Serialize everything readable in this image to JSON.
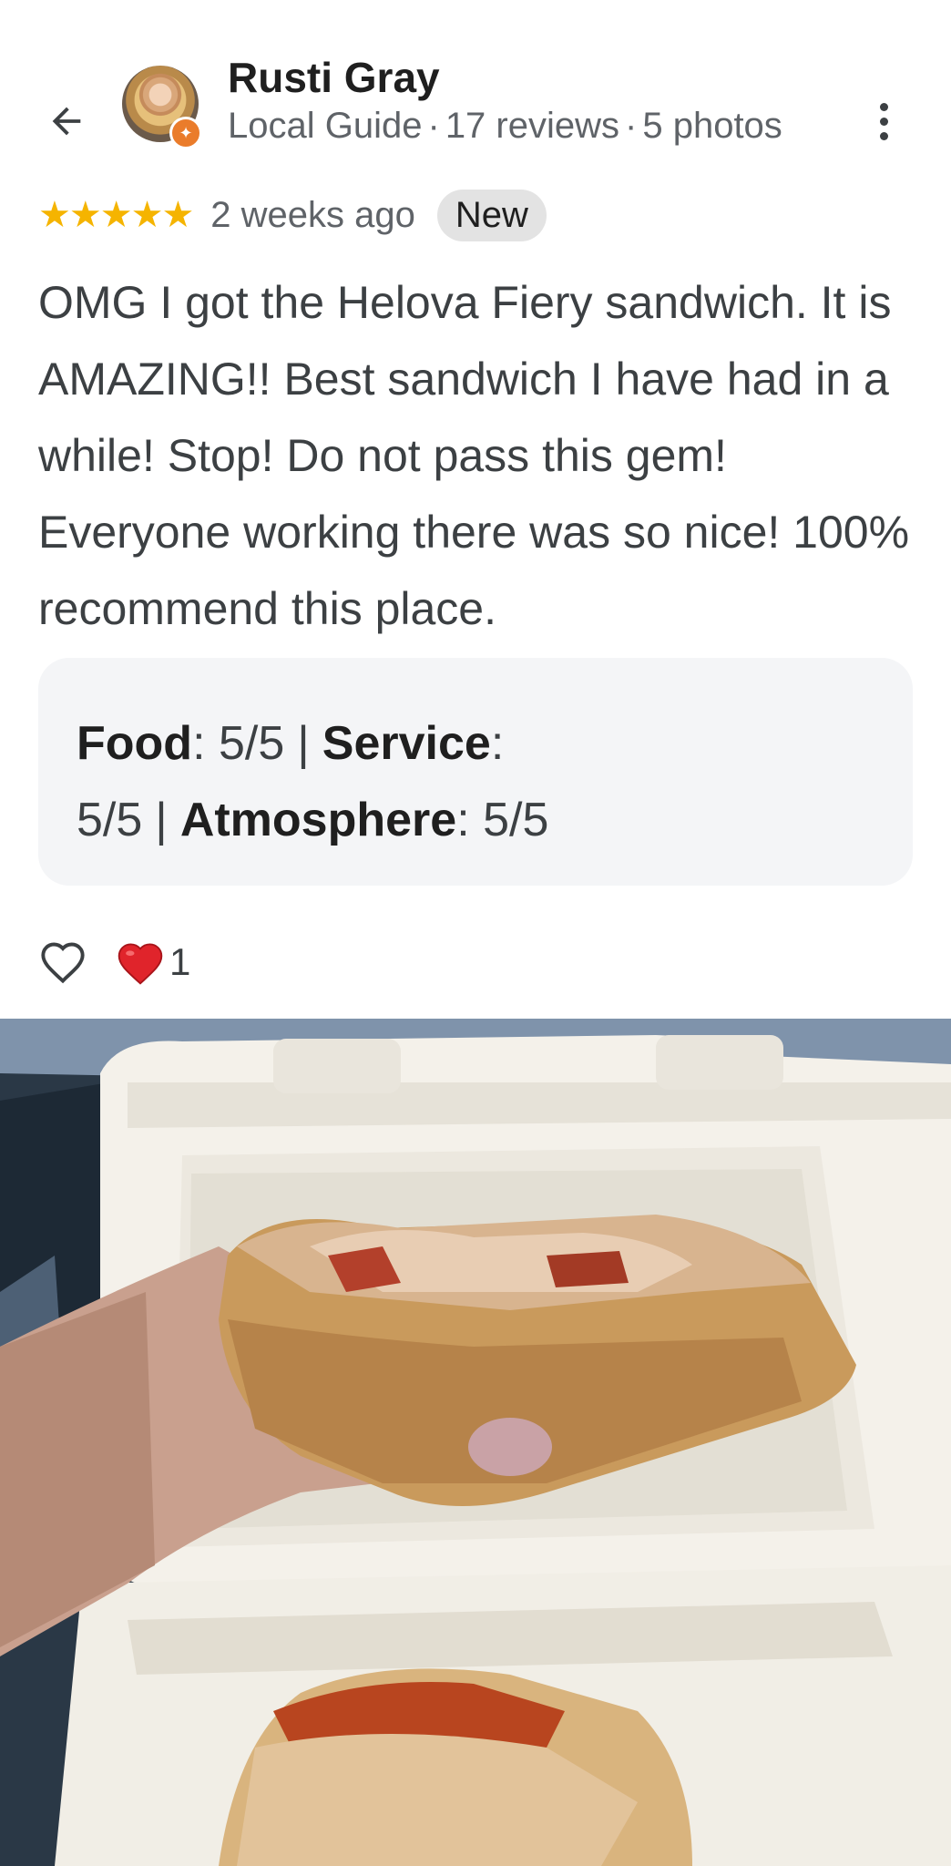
{
  "reviewer": {
    "name": "Rusti Gray",
    "badge": "Local Guide",
    "reviews": "17 reviews",
    "photos": "5 photos",
    "meta_separator": "·"
  },
  "review": {
    "stars": "★★★★★",
    "rating": 5,
    "date": "2 weeks ago",
    "new_badge": "New",
    "text": "OMG I got the Helova Fiery sandwich. It is AMAZING!! Best sandwich I have had in a while! Stop! Do not pass this gem! Everyone working there was so nice! 100% recommend this place."
  },
  "aspects": {
    "food_label": "Food",
    "food_value": "5/5",
    "service_label": "Service",
    "service_value": "5/5",
    "atmosphere_label": "Atmosphere",
    "atmosphere_value": "5/5",
    "separator": "|"
  },
  "reactions": {
    "love_count": "1"
  },
  "icons": {
    "back": "arrow-back-icon",
    "more": "more-vertical-icon",
    "like": "heart-outline-icon",
    "love": "red-heart-icon",
    "guide": "local-guide-badge-icon"
  },
  "colors": {
    "star": "#f5b400",
    "guide_badge": "#ea7c2b",
    "love": "#e0242b",
    "aspects_bg": "#f4f5f7",
    "new_badge_bg": "#e3e3e3"
  }
}
